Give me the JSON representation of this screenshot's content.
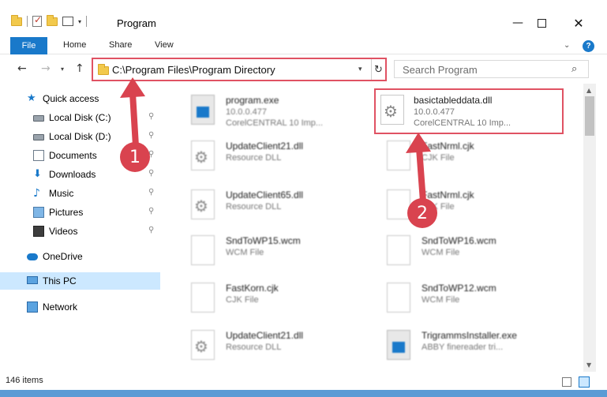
{
  "window": {
    "title": "Program",
    "minimize": "—",
    "close": "✕"
  },
  "ribbon": {
    "tabs": [
      "File",
      "Home",
      "Share",
      "View"
    ],
    "collapse_icon": "chevron-up-icon",
    "help": "?"
  },
  "nav": {
    "back": "←",
    "forward": "→",
    "recent": "▾",
    "up": "↑",
    "address": "C:\\Program Files\\Program Directory",
    "refresh": "↻",
    "search_placeholder": "Search Program",
    "search_icon": "⌕"
  },
  "sidebar": {
    "items": [
      {
        "label": "Quick access",
        "icon": "star-icon",
        "glyph": "★"
      },
      {
        "label": "Local Disk (C:)",
        "icon": "disk-icon",
        "pinned": true
      },
      {
        "label": "Local Disk (D:)",
        "icon": "disk-icon",
        "pinned": true
      },
      {
        "label": "Documents",
        "icon": "documents-icon",
        "pinned": true
      },
      {
        "label": "Downloads",
        "icon": "downloads-icon",
        "glyph": "⬇",
        "pinned": true
      },
      {
        "label": "Music",
        "icon": "music-icon",
        "glyph": "♪",
        "pinned": true
      },
      {
        "label": "Pictures",
        "icon": "pictures-icon",
        "pinned": true
      },
      {
        "label": "Videos",
        "icon": "videos-icon",
        "pinned": true
      },
      {
        "label": "OneDrive",
        "icon": "onedrive-icon"
      },
      {
        "label": "This PC",
        "icon": "this-pc-icon",
        "selected": true
      },
      {
        "label": "Network",
        "icon": "network-icon"
      }
    ],
    "pin_glyph": "📌"
  },
  "files": [
    {
      "name": "program.exe",
      "line1": "10.0.0.477",
      "line2": "CorelCENTRAL 10 Imp...",
      "icon": "exe"
    },
    {
      "name": "basictableddata.dll",
      "line1": "10.0.0.477",
      "line2": "CorelCENTRAL 10 Imp...",
      "icon": "gear",
      "selected": true
    },
    {
      "name": "UpdateClient21.dll",
      "line1": "Resource DLL",
      "line2": "",
      "icon": "gear"
    },
    {
      "name": "FastNrml.cjk",
      "line1": "CJK File",
      "line2": "",
      "icon": "blank"
    },
    {
      "name": "UpdateClient65.dll",
      "line1": "Resource DLL",
      "line2": "",
      "icon": "gear"
    },
    {
      "name": "FastNrml.cjk",
      "line1": "CJK File",
      "line2": "",
      "icon": "blank"
    },
    {
      "name": "SndToWP15.wcm",
      "line1": "WCM File",
      "line2": "",
      "icon": "blank"
    },
    {
      "name": "SndToWP16.wcm",
      "line1": "WCM File",
      "line2": "",
      "icon": "blank"
    },
    {
      "name": "FastKorn.cjk",
      "line1": "CJK File",
      "line2": "",
      "icon": "blank"
    },
    {
      "name": "SndToWP12.wcm",
      "line1": "WCM File",
      "line2": "",
      "icon": "blank"
    },
    {
      "name": "UpdateClient21.dll",
      "line1": "Resource DLL",
      "line2": "",
      "icon": "gear"
    },
    {
      "name": "TrigrammsInstaller.exe",
      "line1": "ABBY finereader tri...",
      "line2": "",
      "icon": "exe"
    }
  ],
  "status": {
    "count": "146 items"
  },
  "annotations": {
    "marker1": "1",
    "marker2": "2",
    "color": "#d9434f"
  }
}
